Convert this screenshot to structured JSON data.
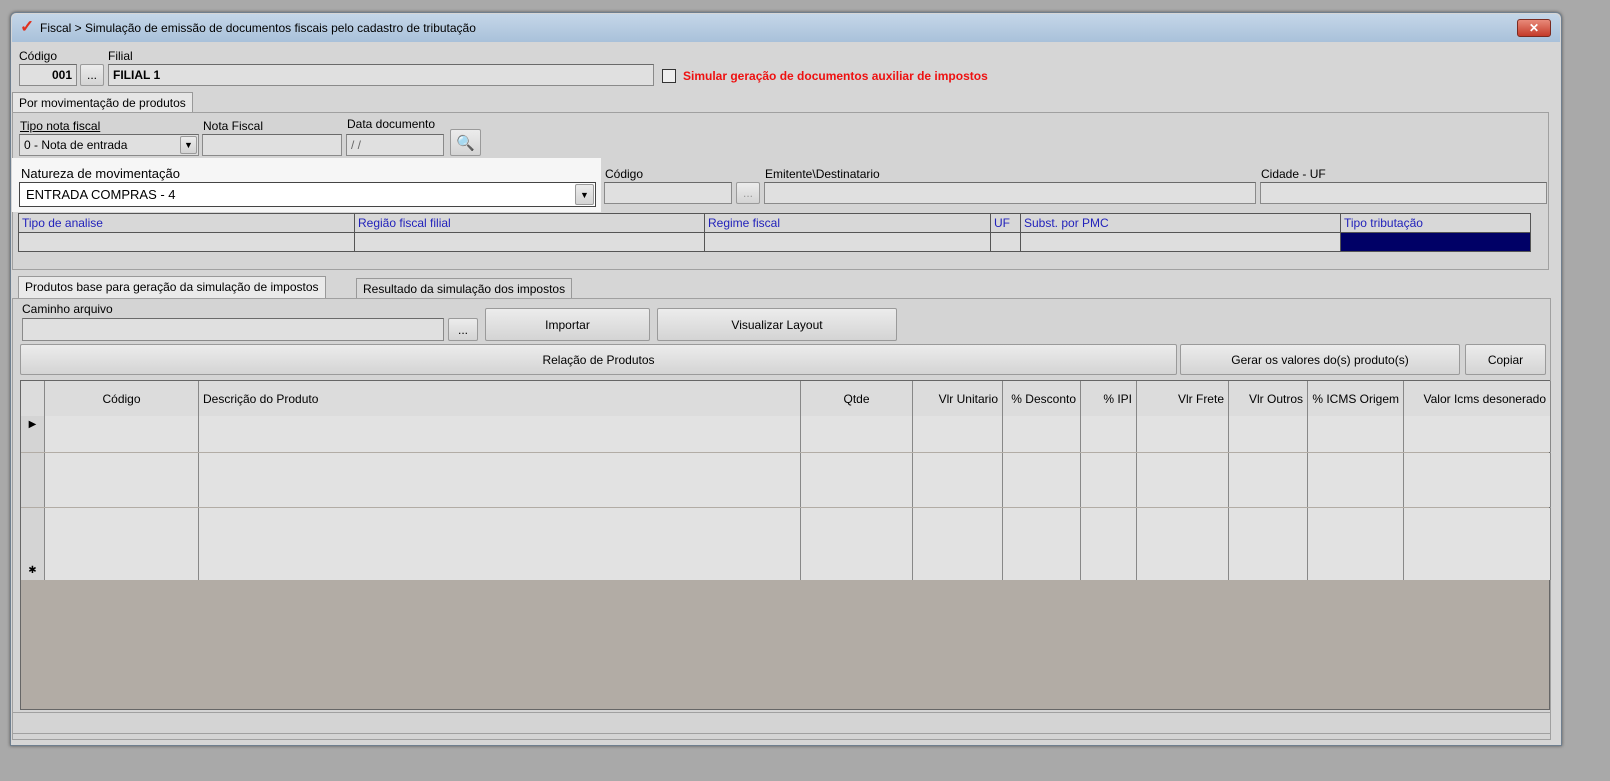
{
  "window": {
    "title": "Fiscal > Simulação de emissão de documentos fiscais pelo cadastro de tributação",
    "close": "✕"
  },
  "header": {
    "codigo_label": "Código",
    "codigo_value": "001",
    "filial_label": "Filial",
    "filial_value": "FILIAL 1",
    "ellipsis": "...",
    "checkbox_label": "Simular geração de documentos auxiliar de impostos"
  },
  "tab_main": "Por movimentação de produtos",
  "form": {
    "tipo_label": "Tipo nota fiscal",
    "tipo_value": "0 - Nota de entrada",
    "nota_label": "Nota Fiscal",
    "nota_value": "",
    "data_label": "Data documento",
    "data_value": " /  /",
    "natureza_label": "Natureza de movimentação",
    "natureza_value": "ENTRADA COMPRAS - 4",
    "codigo_label": "Código",
    "emitente_label": "Emitente\\Destinatario",
    "cidade_label": "Cidade - UF"
  },
  "analysis_columns": [
    "Tipo de analise",
    "Região fiscal filial",
    "Regime fiscal",
    "UF",
    "Subst. por PMC",
    "Tipo tributação"
  ],
  "tabs": [
    "Produtos base para geração da simulação de impostos",
    "Resultado da simulação dos impostos"
  ],
  "import": {
    "caminho_label": "Caminho arquivo",
    "importar": "Importar",
    "visualizar": "Visualizar Layout",
    "relacao": "Relação de Produtos",
    "gerar": "Gerar os valores do(s) produto(s)",
    "copiar": "Copiar"
  },
  "table": {
    "columns": [
      "Código",
      "Descrição do Produto",
      "Qtde",
      "Vlr Unitario",
      "% Desconto",
      "% IPI",
      "Vlr Frete",
      "Vlr Outros",
      "% ICMS Origem",
      "Valor Icms desonerado"
    ],
    "current_marker": "▶",
    "new_marker": "✱"
  },
  "colors": {
    "selected_cell": "#000066",
    "warning": "#ee1111"
  }
}
